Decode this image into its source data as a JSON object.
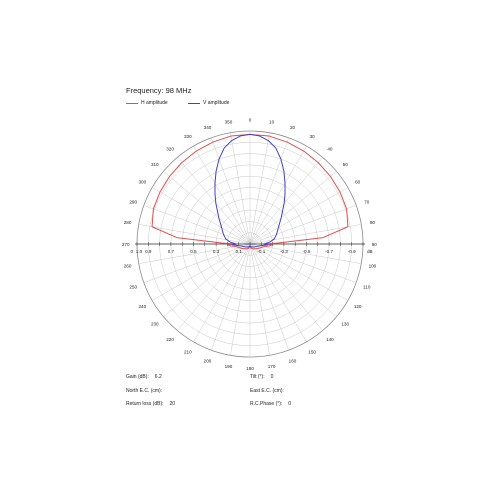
{
  "chart_data": {
    "type": "polar-line",
    "title": "Frequency: 98 MHz",
    "angles_deg": [
      0,
      10,
      20,
      30,
      40,
      50,
      60,
      70,
      80,
      90,
      100,
      110,
      120,
      130,
      140,
      150,
      160,
      170,
      180,
      190,
      200,
      210,
      220,
      230,
      240,
      250,
      260,
      270,
      280,
      290,
      300,
      310,
      320,
      330,
      340,
      350
    ],
    "radial_ticks": [
      "0.9",
      "0.7",
      "0.5",
      "0.3",
      "0.1"
    ],
    "radial_ticks_right": [
      "-0.1",
      "-0.3",
      "-0.5",
      "-0.7",
      "-0.9"
    ],
    "left_end_label": "0",
    "left_end_label_2": "1.0",
    "right_end_label": "dB",
    "series": [
      {
        "name": "H amplitude",
        "color": "#e05050",
        "points": [
          [
            0,
            0.97
          ],
          [
            10,
            0.97
          ],
          [
            20,
            0.96
          ],
          [
            30,
            0.95
          ],
          [
            40,
            0.94
          ],
          [
            50,
            0.93
          ],
          [
            60,
            0.92
          ],
          [
            70,
            0.91
          ],
          [
            80,
            0.88
          ],
          [
            85,
            0.65
          ],
          [
            88,
            0.25
          ],
          [
            90,
            0.12
          ],
          [
            92,
            0.2
          ],
          [
            96,
            0.17
          ],
          [
            100,
            0.13
          ],
          [
            120,
            0.08
          ],
          [
            150,
            0.05
          ],
          [
            180,
            0.03
          ],
          [
            210,
            0.05
          ],
          [
            240,
            0.08
          ],
          [
            260,
            0.13
          ],
          [
            264,
            0.17
          ],
          [
            268,
            0.2
          ],
          [
            270,
            0.12
          ],
          [
            272,
            0.25
          ],
          [
            275,
            0.65
          ],
          [
            280,
            0.88
          ],
          [
            290,
            0.91
          ],
          [
            300,
            0.92
          ],
          [
            310,
            0.93
          ],
          [
            320,
            0.94
          ],
          [
            330,
            0.95
          ],
          [
            340,
            0.96
          ],
          [
            350,
            0.97
          ],
          [
            360,
            0.97
          ]
        ]
      },
      {
        "name": "V amplitude",
        "color": "#4040c8",
        "points": [
          [
            0,
            0.97
          ],
          [
            5,
            0.96
          ],
          [
            10,
            0.93
          ],
          [
            15,
            0.88
          ],
          [
            20,
            0.8
          ],
          [
            25,
            0.71
          ],
          [
            30,
            0.62
          ],
          [
            35,
            0.54
          ],
          [
            40,
            0.47
          ],
          [
            50,
            0.36
          ],
          [
            60,
            0.29
          ],
          [
            70,
            0.25
          ],
          [
            78,
            0.22
          ],
          [
            84,
            0.18
          ],
          [
            88,
            0.14
          ],
          [
            90,
            0.12
          ],
          [
            92,
            0.16
          ],
          [
            96,
            0.12
          ],
          [
            100,
            0.09
          ],
          [
            120,
            0.05
          ],
          [
            150,
            0.03
          ],
          [
            180,
            0.02
          ],
          [
            210,
            0.03
          ],
          [
            240,
            0.05
          ],
          [
            260,
            0.09
          ],
          [
            264,
            0.12
          ],
          [
            268,
            0.16
          ],
          [
            270,
            0.12
          ],
          [
            272,
            0.14
          ],
          [
            276,
            0.18
          ],
          [
            282,
            0.22
          ],
          [
            290,
            0.25
          ],
          [
            300,
            0.29
          ],
          [
            310,
            0.36
          ],
          [
            320,
            0.47
          ],
          [
            325,
            0.54
          ],
          [
            330,
            0.62
          ],
          [
            335,
            0.71
          ],
          [
            340,
            0.8
          ],
          [
            345,
            0.88
          ],
          [
            350,
            0.93
          ],
          [
            355,
            0.96
          ],
          [
            360,
            0.97
          ]
        ]
      }
    ]
  },
  "legend": {
    "h_label": "H amplitude",
    "v_label": "V amplitude",
    "h_color": "#e05050",
    "v_color": "#4040c8"
  },
  "info": {
    "gain_label": "Gain (dB):",
    "gain_value": "6.2",
    "north_label": "North E.C. (cm):",
    "north_value": "",
    "return_label": "Return loss (dB):",
    "return_value": "20",
    "tilt_label": "Tilt (°):",
    "tilt_value": "0",
    "east_label": "East E.C. (cm):",
    "east_value": "",
    "phase_label": "R.C.Phase (°):",
    "phase_value": "0"
  }
}
